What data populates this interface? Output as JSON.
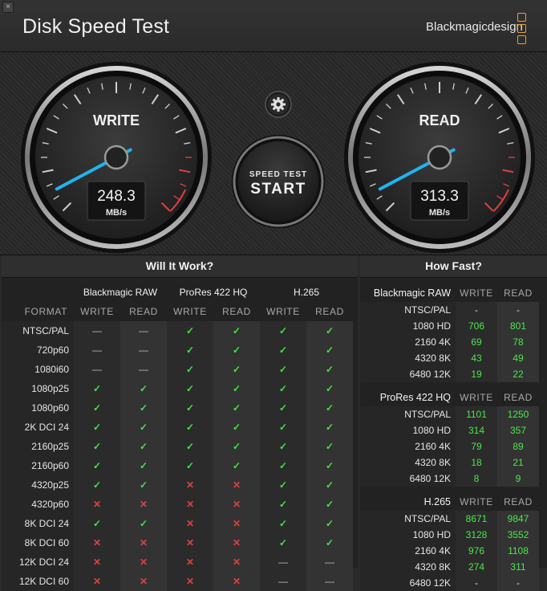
{
  "window": {
    "close_glyph": "×"
  },
  "header": {
    "title": "Disk Speed Test",
    "brand": "Blackmagicdesign"
  },
  "write_gauge": {
    "label": "WRITE",
    "value": "248.3",
    "unit": "MB/s"
  },
  "read_gauge": {
    "label": "READ",
    "value": "313.3",
    "unit": "MB/s"
  },
  "start_button": {
    "line1": "SPEED TEST",
    "line2": "START"
  },
  "will_it_work": {
    "title": "Will It Work?",
    "format_label": "FORMAT",
    "groups": [
      "Blackmagic RAW",
      "ProRes 422 HQ",
      "H.265"
    ],
    "sub_labels": [
      "WRITE",
      "READ"
    ],
    "rows": [
      {
        "format": "NTSC/PAL",
        "cells": [
          "na",
          "na",
          "ok",
          "ok",
          "ok",
          "ok"
        ]
      },
      {
        "format": "720p60",
        "cells": [
          "na",
          "na",
          "ok",
          "ok",
          "ok",
          "ok"
        ]
      },
      {
        "format": "1080i60",
        "cells": [
          "na",
          "na",
          "ok",
          "ok",
          "ok",
          "ok"
        ]
      },
      {
        "format": "1080p25",
        "cells": [
          "ok",
          "ok",
          "ok",
          "ok",
          "ok",
          "ok"
        ]
      },
      {
        "format": "1080p60",
        "cells": [
          "ok",
          "ok",
          "ok",
          "ok",
          "ok",
          "ok"
        ]
      },
      {
        "format": "2K DCI 24",
        "cells": [
          "ok",
          "ok",
          "ok",
          "ok",
          "ok",
          "ok"
        ]
      },
      {
        "format": "2160p25",
        "cells": [
          "ok",
          "ok",
          "ok",
          "ok",
          "ok",
          "ok"
        ]
      },
      {
        "format": "2160p60",
        "cells": [
          "ok",
          "ok",
          "ok",
          "ok",
          "ok",
          "ok"
        ]
      },
      {
        "format": "4320p25",
        "cells": [
          "ok",
          "ok",
          "no",
          "no",
          "ok",
          "ok"
        ]
      },
      {
        "format": "4320p60",
        "cells": [
          "no",
          "no",
          "no",
          "no",
          "ok",
          "ok"
        ]
      },
      {
        "format": "8K DCI 24",
        "cells": [
          "ok",
          "ok",
          "no",
          "no",
          "ok",
          "ok"
        ]
      },
      {
        "format": "8K DCI 60",
        "cells": [
          "no",
          "no",
          "no",
          "no",
          "ok",
          "ok"
        ]
      },
      {
        "format": "12K DCI 24",
        "cells": [
          "no",
          "no",
          "no",
          "no",
          "na",
          "na"
        ]
      },
      {
        "format": "12K DCI 60",
        "cells": [
          "no",
          "no",
          "no",
          "no",
          "na",
          "na"
        ]
      }
    ],
    "symbols": {
      "ok": "✓",
      "no": "✕",
      "na": "—"
    }
  },
  "how_fast": {
    "title": "How Fast?",
    "sub_labels": [
      "WRITE",
      "READ"
    ],
    "groups": [
      {
        "name": "Blackmagic RAW",
        "rows": [
          {
            "format": "NTSC/PAL",
            "write": "-",
            "read": "-"
          },
          {
            "format": "1080 HD",
            "write": "706",
            "read": "801"
          },
          {
            "format": "2160 4K",
            "write": "69",
            "read": "78"
          },
          {
            "format": "4320 8K",
            "write": "43",
            "read": "49"
          },
          {
            "format": "6480 12K",
            "write": "19",
            "read": "22"
          }
        ]
      },
      {
        "name": "ProRes 422 HQ",
        "rows": [
          {
            "format": "NTSC/PAL",
            "write": "1101",
            "read": "1250"
          },
          {
            "format": "1080 HD",
            "write": "314",
            "read": "357"
          },
          {
            "format": "2160 4K",
            "write": "79",
            "read": "89"
          },
          {
            "format": "4320 8K",
            "write": "18",
            "read": "21"
          },
          {
            "format": "6480 12K",
            "write": "8",
            "read": "9"
          }
        ]
      },
      {
        "name": "H.265",
        "rows": [
          {
            "format": "NTSC/PAL",
            "write": "8671",
            "read": "9847"
          },
          {
            "format": "1080 HD",
            "write": "3128",
            "read": "3552"
          },
          {
            "format": "2160 4K",
            "write": "976",
            "read": "1108"
          },
          {
            "format": "4320 8K",
            "write": "274",
            "read": "311"
          },
          {
            "format": "6480 12K",
            "write": "-",
            "read": "-"
          }
        ]
      }
    ]
  },
  "colors": {
    "accent_needle": "#1fb4f0",
    "ok": "#3fe83f",
    "no": "#e04040",
    "brand_logo": "#f0a030"
  }
}
